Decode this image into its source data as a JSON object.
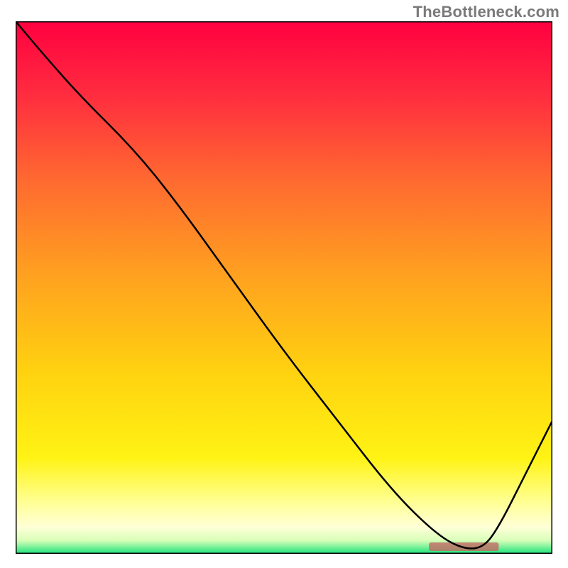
{
  "watermark": "TheBottleneck.com",
  "colors": {
    "gradient_stops": [
      {
        "offset": "0%",
        "color": "#ff0040"
      },
      {
        "offset": "14%",
        "color": "#ff2d3f"
      },
      {
        "offset": "30%",
        "color": "#ff6a30"
      },
      {
        "offset": "48%",
        "color": "#ffa21f"
      },
      {
        "offset": "66%",
        "color": "#ffd210"
      },
      {
        "offset": "82%",
        "color": "#fff314"
      },
      {
        "offset": "90%",
        "color": "#ffff90"
      },
      {
        "offset": "95%",
        "color": "#ffffd8"
      },
      {
        "offset": "97.5%",
        "color": "#d8ffb8"
      },
      {
        "offset": "100%",
        "color": "#19e37a"
      }
    ],
    "curve_stroke": "#000000",
    "border_stroke": "#000000",
    "highlight_fill": "#c86060"
  },
  "chart_data": {
    "type": "line",
    "title": "",
    "xlabel": "",
    "ylabel": "",
    "xlim": [
      0,
      100
    ],
    "ylim": [
      0,
      100
    ],
    "grid": false,
    "legend": false,
    "x": [
      0,
      5,
      12,
      22,
      30,
      40,
      50,
      60,
      70,
      78,
      83,
      87,
      90,
      95,
      100
    ],
    "values": [
      100,
      94,
      86,
      76,
      66,
      52,
      38,
      25,
      12,
      4,
      1,
      1,
      5,
      15,
      25
    ],
    "highlight_range_x": [
      77,
      90
    ],
    "annotations": []
  }
}
